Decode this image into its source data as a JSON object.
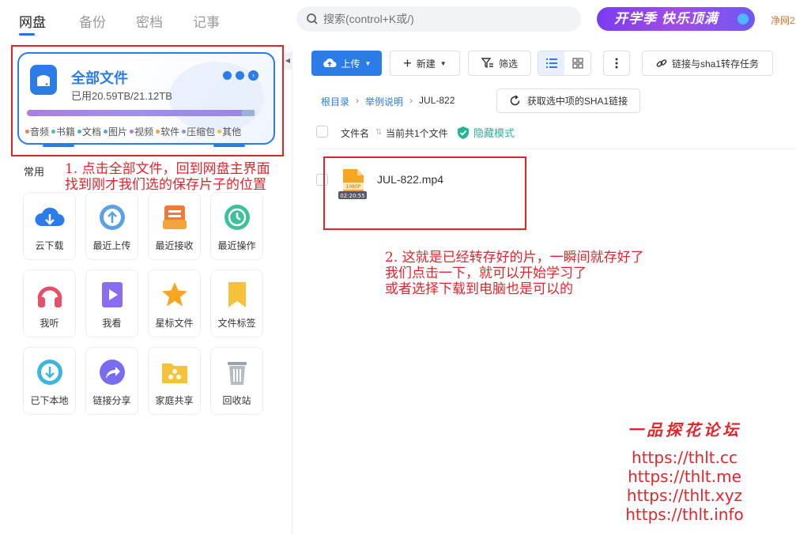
{
  "nav": {
    "tabs": [
      {
        "label": "网盘",
        "active": true
      },
      {
        "label": "备份",
        "active": false
      },
      {
        "label": "密档",
        "active": false
      },
      {
        "label": "记事",
        "active": false
      }
    ],
    "search_placeholder": "搜索(control+K或/)",
    "banner_text": "开学季 快乐顶满",
    "brand_right": "净网2"
  },
  "storage": {
    "title": "全部文件",
    "usage": "已用20.59TB/21.12TB",
    "used_fraction": 0.975,
    "legend": [
      {
        "label": "音频",
        "color": "#ef7a5a"
      },
      {
        "label": "书籍",
        "color": "#4bbf9a"
      },
      {
        "label": "文档",
        "color": "#36b2c9"
      },
      {
        "label": "图片",
        "color": "#5aa2e6"
      },
      {
        "label": "视频",
        "color": "#a97fe0"
      },
      {
        "label": "软件",
        "color": "#f0a23e"
      },
      {
        "label": "压缩包",
        "color": "#8a8fe8"
      },
      {
        "label": "其他",
        "color": "#f0c043"
      }
    ]
  },
  "common": {
    "label": "常用",
    "items": [
      {
        "label": "云下载",
        "icon": "cloud-download-icon"
      },
      {
        "label": "最近上传",
        "icon": "recent-upload-icon"
      },
      {
        "label": "最近接收",
        "icon": "recent-receive-icon"
      },
      {
        "label": "最近操作",
        "icon": "recent-operation-icon"
      },
      {
        "label": "我听",
        "icon": "headphones-icon"
      },
      {
        "label": "我看",
        "icon": "video-play-icon"
      },
      {
        "label": "星标文件",
        "icon": "star-icon"
      },
      {
        "label": "文件标签",
        "icon": "bookmark-icon"
      },
      {
        "label": "已下本地",
        "icon": "downloaded-icon"
      },
      {
        "label": "链接分享",
        "icon": "share-icon"
      },
      {
        "label": "家庭共享",
        "icon": "family-folder-icon"
      },
      {
        "label": "回收站",
        "icon": "trash-icon"
      }
    ]
  },
  "toolbar": {
    "upload": "上传",
    "new": "新建",
    "filter": "筛选",
    "sha1_task": "链接与sha1转存任务"
  },
  "breadcrumb": {
    "root": "根目录",
    "folder": "举例说明",
    "current": "JUL-822"
  },
  "sha_button": "获取选中项的SHA1链接",
  "list": {
    "col_name": "文件名",
    "count": "当前共1个文件",
    "hide_mode": "隐藏模式",
    "files": [
      {
        "name": "JUL-822.mp4",
        "duration": "02:20:55",
        "quality": "1080P"
      }
    ]
  },
  "annotations": {
    "step1_line1": "1. 点击全部文件，回到网盘主界面",
    "step1_line2": "找到刚才我们选的保存片子的位置",
    "step2_line1": "2. 这就是已经转存好的片，一瞬间就存好了",
    "step2_line2": "我们点击一下，就可以开始学习了",
    "step2_line3": "或者选择下载到电脑也是可以的"
  },
  "watermark": {
    "title": "一品探花论坛",
    "urls": [
      "https://thlt.cc",
      "https://thlt.me",
      "https://thlt.xyz",
      "https://thlt.info"
    ]
  },
  "colors": {
    "accent": "#2b7be8",
    "annotation": "#e3252b",
    "hide_mode": "#27b39a"
  }
}
